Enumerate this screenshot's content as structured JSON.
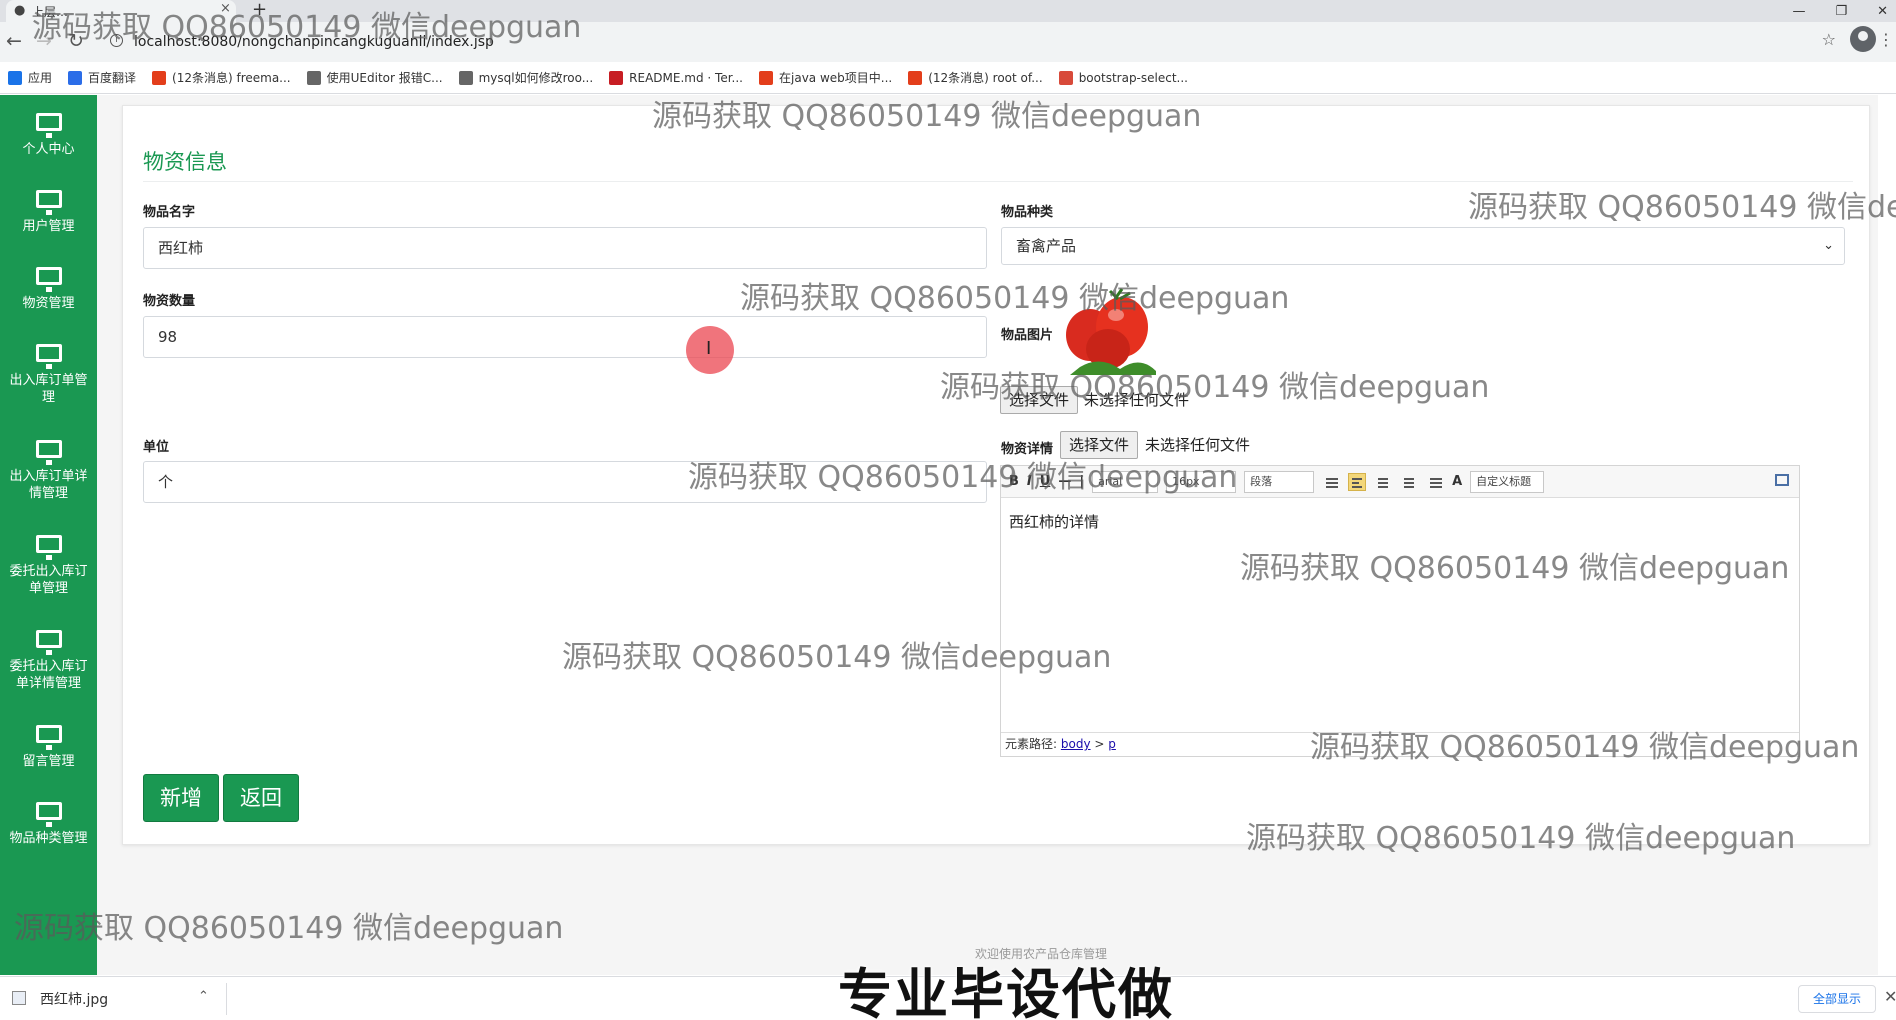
{
  "browser": {
    "tab_title": "上层…",
    "url": "localhost:8080/nongchanpincangkuguanli/index.jsp",
    "bookmarks": [
      {
        "label": "应用",
        "icon": "apps-grid-icon",
        "color": "#1a73e8"
      },
      {
        "label": "百度翻译",
        "icon": "baidu-translate-icon",
        "color": "#2b6de8"
      },
      {
        "label": "(12条消息) freema...",
        "icon": "csdn-icon",
        "color": "#e33e1b"
      },
      {
        "label": "使用UEditor 报错C...",
        "icon": "link-icon",
        "color": "#666666"
      },
      {
        "label": "mysql如何修改roo...",
        "icon": "link-icon",
        "color": "#666666"
      },
      {
        "label": "README.md · Ter...",
        "icon": "gitee-icon",
        "color": "#c71d23"
      },
      {
        "label": "在java web项目中...",
        "icon": "csdn-icon",
        "color": "#e33e1b"
      },
      {
        "label": "(12条消息) root of...",
        "icon": "csdn-icon",
        "color": "#e33e1b"
      },
      {
        "label": "bootstrap-select...",
        "icon": "bootstrap-icon",
        "color": "#d84a3a"
      }
    ]
  },
  "sidebar": {
    "items": [
      {
        "label": "个人中心"
      },
      {
        "label": "用户管理"
      },
      {
        "label": "物资管理"
      },
      {
        "label": "出入库订单管理"
      },
      {
        "label": "出入库订单详情管理"
      },
      {
        "label": "委托出入库订单管理"
      },
      {
        "label": "委托出入库订单详情管理"
      },
      {
        "label": "留言管理"
      },
      {
        "label": "物品种类管理"
      }
    ],
    "bg_color": "#1a9852"
  },
  "form": {
    "title": "物资信息",
    "name_label": "物品名字",
    "name_value": "西红柿",
    "category_label": "物品种类",
    "category_value": "畜禽产品",
    "quantity_label": "物资数量",
    "quantity_value": "98",
    "image_label": "物品图片",
    "choose_file": "选择文件",
    "no_file": "未选择任何文件",
    "unit_label": "单位",
    "unit_value": "个",
    "detail_label": "物资详情",
    "detail_choose_file": "选择文件",
    "detail_no_file": "未选择任何文件",
    "add_button": "新增",
    "back_button": "返回",
    "accent_color": "#1a9852"
  },
  "editor": {
    "font_family": "arial",
    "font_size": "16px",
    "paragraph": "段落",
    "custom_title": "自定义标题",
    "content": "西红柿的详情",
    "path_label": "元素路径:",
    "path_body": "body",
    "path_sep": ">",
    "path_p": "p"
  },
  "footer": {
    "text": "欢迎使用农产品仓库管理"
  },
  "download_bar": {
    "file_name": "西红柿.jpg",
    "show_all": "全部显示"
  },
  "overlay": {
    "watermark": "源码获取 QQ86050149 微信deepguan",
    "watermark_cut": "源码获取 QQ86050149 微信de",
    "caption": "专业毕设代做"
  }
}
